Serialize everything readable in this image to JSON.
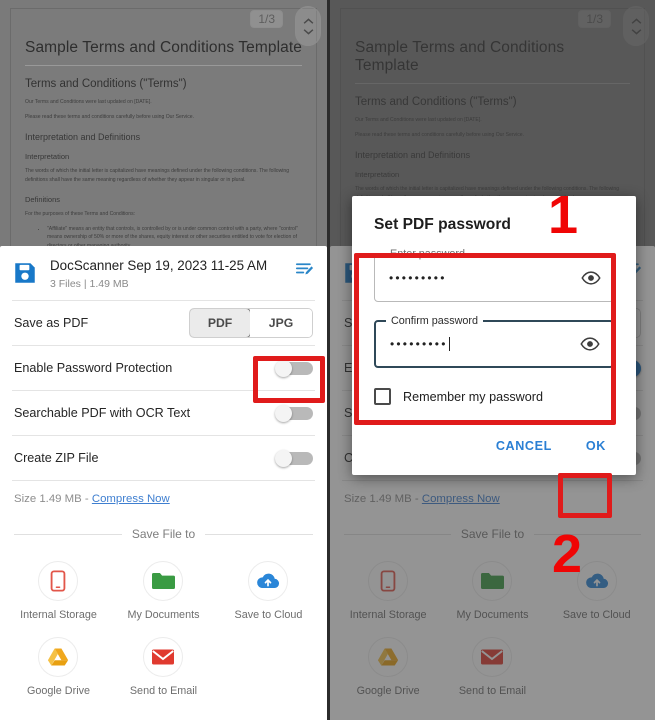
{
  "document_preview": {
    "page_badge": "1/3",
    "title": "Sample Terms and Conditions Template",
    "heading_terms": "Terms and Conditions (\"Terms\")",
    "para_updated": "Our Terms and Conditions were last updated on [DATE].",
    "para_read": "Please read these terms and conditions carefully before using Our Service.",
    "heading_interpretation_definitions": "Interpretation and Definitions",
    "heading_interpretation": "Interpretation",
    "para_interpretation": "The words of which the initial letter is capitalized have meanings defined under the following conditions. The following definitions shall have the same meaning regardless of whether they appear in singular or in plural.",
    "heading_definitions": "Definitions",
    "para_purposes": "For the purposes of these Terms and Conditions:",
    "bullet_affiliate": "\"Affiliate\" means an entity that controls, is controlled by or is under common control with a party, where \"control\" means ownership of 50% or more of the shares, equity interest or other securities entitled to vote for election of directors or other managing authority."
  },
  "sheet": {
    "file_title": "DocScanner Sep 19, 2023 11-25 AM",
    "file_meta": "3 Files  |  1.49 MB",
    "save_as_label": "Save as PDF",
    "format_options": [
      "PDF",
      "JPG"
    ],
    "format_selected": "PDF",
    "rows": [
      {
        "label": "Enable Password Protection",
        "state_left": "off",
        "state_right": "on"
      },
      {
        "label": "Searchable PDF with OCR Text",
        "state_left": "off",
        "state_right": "off"
      },
      {
        "label": "Create ZIP File",
        "state_left": "off",
        "state_right": "off"
      }
    ],
    "size_prefix": "Size 1.49 MB - ",
    "compress_link": "Compress Now",
    "save_file_to": "Save File to",
    "destinations": [
      {
        "label": "Internal Storage",
        "icon": "phone-icon",
        "color": "#e2564a"
      },
      {
        "label": "My Documents",
        "icon": "folder-icon",
        "color": "#3a9b43"
      },
      {
        "label": "Save to Cloud",
        "icon": "cloud-upload-icon",
        "color": "#2a86d8"
      },
      {
        "label": "Google Drive",
        "icon": "google-drive-icon",
        "color": "#f0a81e"
      },
      {
        "label": "Send to Email",
        "icon": "envelope-icon",
        "color": "#e03a2f"
      }
    ]
  },
  "dialog": {
    "title": "Set PDF password",
    "enter_password_legend": "Enter password",
    "enter_password_value": "•••••••••",
    "confirm_password_legend": "Confirm password",
    "confirm_password_value": "•••••••••",
    "remember_label": "Remember my password",
    "remember_checked": false,
    "cancel_label": "CANCEL",
    "ok_label": "OK"
  },
  "annotations": {
    "step_one": "1",
    "step_two": "2",
    "highlight_color": "#e01b1b"
  }
}
